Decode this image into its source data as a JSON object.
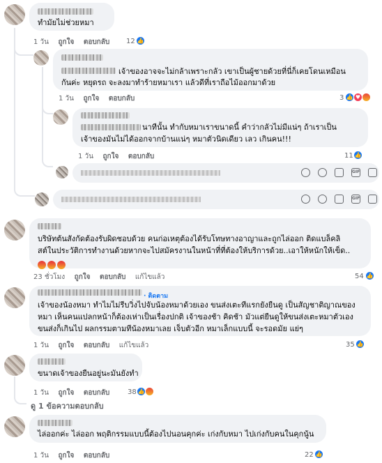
{
  "comments": [
    {
      "text": [
        "ทำมัยไม่ช่วยหมา"
      ],
      "time": "1 วัน",
      "like": "ถูกใจ",
      "reply": "ตอบกลับ",
      "count": "12"
    },
    {
      "text": [
        "เจ้าของอาจจะไม่กล้าเพราะกลัว เขาเป็นผู้ชายด้วยที่นี่ก็เคยโดนเหมือน",
        "กันค่ะ หยุดรถ จะลงมาทำร้ายหมาเรา แล้วดีที่เราถือไม้ออกมาด้วย"
      ],
      "time": "1 วัน",
      "like": "ถูกใจ",
      "reply": "ตอบกลับ",
      "count": "3"
    },
    {
      "text": [
        "นาทีนั้น ทำกับหมาเราขนาดนี้ คำว่ากลัวไม่มีแน่ๆ ถ้าเราเป็น",
        "เจ้าของมันไม่ได้ออกจากบ้านแน่ๆ หมาตัวนิดเดียว เลว เกินคน!!!"
      ],
      "time": "1 วัน",
      "like": "ถูกใจ",
      "reply": "ตอบกลับ",
      "count": "11"
    },
    {
      "text": [
        "บริษัทต้นสังกัดต้องรับผิดชอบด้วย คนก่อเหตุต้องได้รับโทษทางอาญาและถูกไล่ออก ติดแบล็คลิ",
        "สต์ในประวัติการทำงานด้วยหากจะไปสมัครงานในหน้าที่ที่ต้องให้บริการด้วย..เอาให้หนักให้เข็ด.."
      ],
      "time": "23 ชั่วโมง",
      "like": "ถูกใจ",
      "reply": "ตอบกลับ",
      "edited": "แก้ไขแล้ว",
      "count": "54"
    },
    {
      "text": [
        "เจ้าของน้องหมา ทำไมไม่รีบวิ่งไปจับน้องหมาด้วยเอง ขนส่งเตะทีแรกยังยืนดู เป็นสัญชาติญาณของ",
        "หมา เห็นคนแปลกหน้าก็ต้องเห่าเป็นเรื่องปกติ เจ้าของช้า คิดช้า มัวแต่ยืนดูให้ขนส่งเตะหมาตัวเอง",
        "ขนส่งก็เกินไป ผลกรรมตามทีน้องหมาเลย เจ็บตัวอีก หมาเล็กแบบนี้ จะรอดมัย แย่ๆ"
      ],
      "follow": "· ติดตาม",
      "time": "1 วัน",
      "like": "ถูกใจ",
      "reply": "ตอบกลับ",
      "edited": "แก้ไขแล้ว",
      "count": "35"
    },
    {
      "text": [
        "ขนาดเจ้าของยืนอยู่นะมันยังทำ"
      ],
      "time": "1 วัน",
      "like": "ถูกใจ",
      "reply": "ตอบกลับ",
      "count": "38"
    },
    {
      "text": [
        "ไล่ออกค่ะ ไล่ออก พฤติกรรมแบบนี้ต้องไปนอนคุกค่ะ เก่งกับหมา ไปเก่งกับคนในคุกนู้น"
      ],
      "time": "1 วัน",
      "like": "ถูกใจ",
      "reply": "ตอบกลับ",
      "count": "22"
    }
  ],
  "view_replies": "ดู 1 ข้อความตอบกลับ",
  "composer_icons": [
    "emoji-icon",
    "sticker-icon",
    "camera-icon",
    "gif-icon",
    "avatar-sticker-icon"
  ]
}
